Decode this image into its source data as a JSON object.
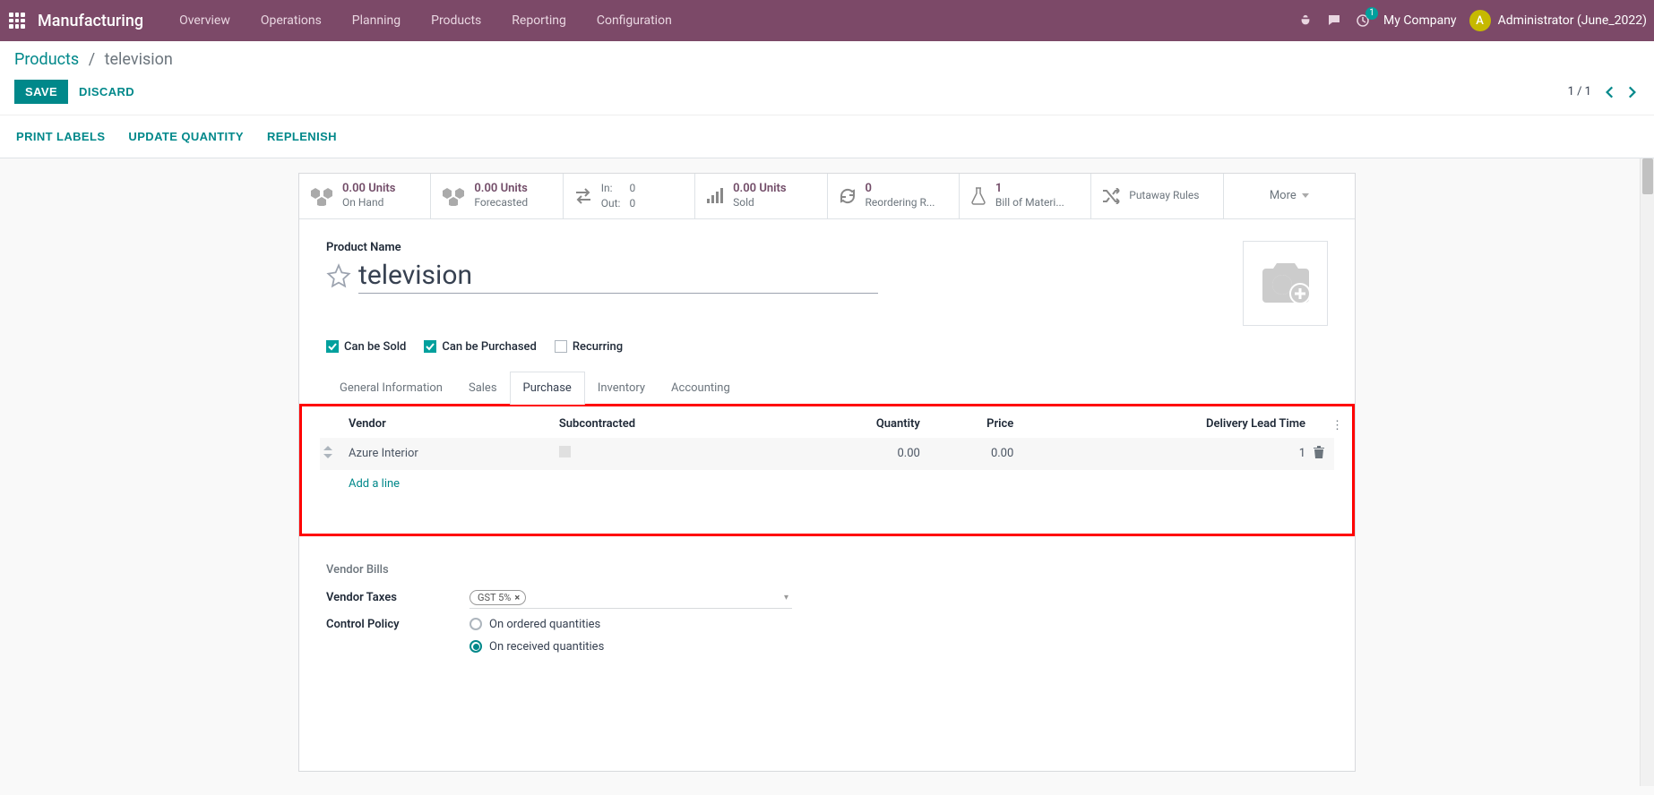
{
  "topbar": {
    "app_title": "Manufacturing",
    "menu": [
      "Overview",
      "Operations",
      "Planning",
      "Products",
      "Reporting",
      "Configuration"
    ],
    "activity_count": "1",
    "company": "My Company",
    "user_initial": "A",
    "user_name": "Administrator (June_2022)"
  },
  "breadcrumb": {
    "root": "Products",
    "current": "television"
  },
  "buttons": {
    "save": "SAVE",
    "discard": "DISCARD",
    "print_labels": "PRINT LABELS",
    "update_qty": "UPDATE QUANTITY",
    "replenish": "REPLENISH"
  },
  "pager": {
    "text": "1 / 1"
  },
  "stats": {
    "on_hand": {
      "value": "0.00 Units",
      "label": "On Hand"
    },
    "forecasted": {
      "value": "0.00 Units",
      "label": "Forecasted"
    },
    "inout": {
      "in_label": "In:",
      "in_val": "0",
      "out_label": "Out:",
      "out_val": "0"
    },
    "sold": {
      "value": "0.00 Units",
      "label": "Sold"
    },
    "reorder": {
      "value": "0",
      "label": "Reordering R..."
    },
    "bom": {
      "value": "1",
      "label": "Bill of Materi..."
    },
    "putaway": {
      "label": "Putaway Rules"
    },
    "more": "More"
  },
  "form": {
    "product_name_label": "Product Name",
    "product_name": "television",
    "can_be_sold": "Can be Sold",
    "can_be_purchased": "Can be Purchased",
    "recurring": "Recurring"
  },
  "tabs": [
    "General Information",
    "Sales",
    "Purchase",
    "Inventory",
    "Accounting"
  ],
  "active_tab_index": 2,
  "vendor_table": {
    "headers": {
      "vendor": "Vendor",
      "subcontracted": "Subcontracted",
      "quantity": "Quantity",
      "price": "Price",
      "lead_time": "Delivery Lead Time"
    },
    "rows": [
      {
        "vendor": "Azure Interior",
        "quantity": "0.00",
        "price": "0.00",
        "lead_time": "1"
      }
    ],
    "add_line": "Add a line"
  },
  "vendor_bills": {
    "section": "Vendor Bills",
    "vendor_taxes_label": "Vendor Taxes",
    "tax_tag": "GST 5%",
    "control_policy_label": "Control Policy",
    "on_ordered": "On ordered quantities",
    "on_received": "On received quantities"
  }
}
